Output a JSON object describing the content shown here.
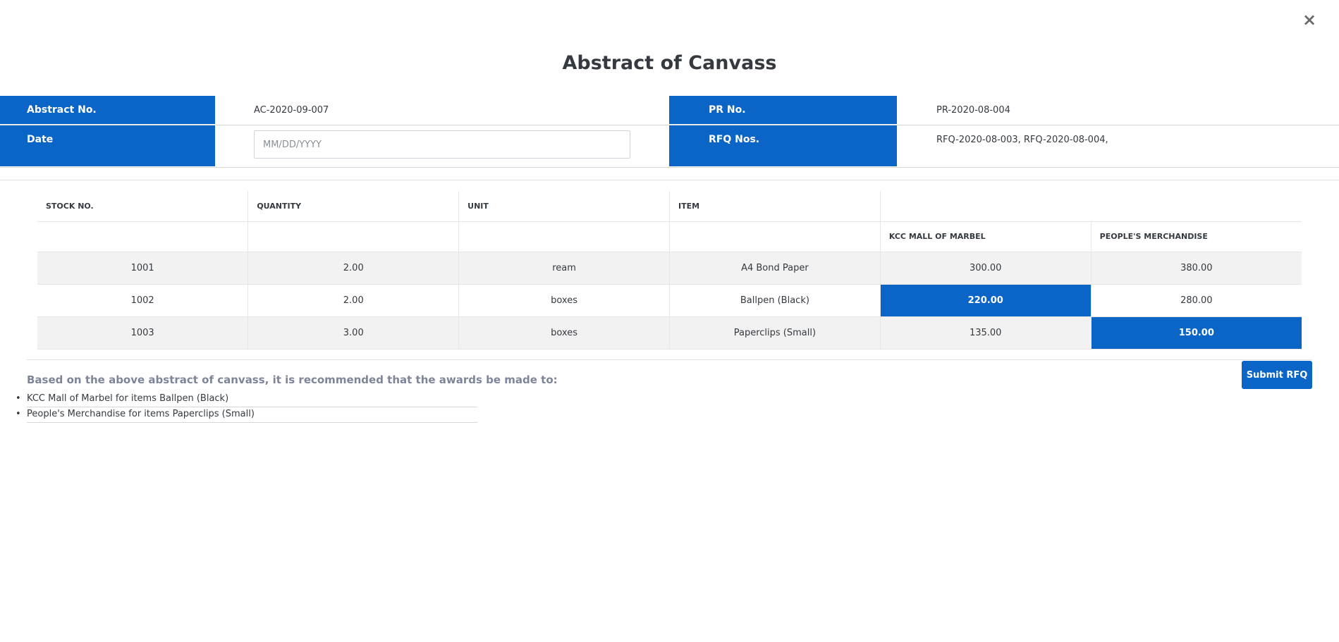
{
  "modal": {
    "close_symbol": "×",
    "close_icon": "close-icon",
    "title": "Abstract of Canvass"
  },
  "info": {
    "abstract_no_label": "Abstract No.",
    "abstract_no_value": "AC-2020-09-007",
    "pr_no_label": "PR No.",
    "pr_no_value": "PR-2020-08-004",
    "date_label": "Date",
    "date_placeholder": "MM/DD/YYYY",
    "date_value": "",
    "rfq_label": "RFQ Nos.",
    "rfq_value": "RFQ-2020-08-003, RFQ-2020-08-004,"
  },
  "table": {
    "headers": [
      "STOCK NO.",
      "QUANTITY",
      "UNIT",
      "ITEM"
    ],
    "suppliers": [
      "KCC MALL OF MARBEL",
      "PEOPLE'S MERCHANDISE"
    ],
    "rows": [
      {
        "stock_no": "1001",
        "quantity": "2.00",
        "unit": "ream",
        "item": "A4 Bond Paper",
        "prices": [
          "300.00",
          "380.00"
        ],
        "awarded_index": null
      },
      {
        "stock_no": "1002",
        "quantity": "2.00",
        "unit": "boxes",
        "item": "Ballpen (Black)",
        "prices": [
          "220.00",
          "280.00"
        ],
        "awarded_index": 0
      },
      {
        "stock_no": "1003",
        "quantity": "3.00",
        "unit": "boxes",
        "item": "Paperclips (Small)",
        "prices": [
          "135.00",
          "150.00"
        ],
        "awarded_index": 1
      }
    ]
  },
  "recommendation": {
    "title": "Based on the above abstract of canvass, it is recommended that the awards be made to:",
    "items": [
      "KCC Mall of Marbel for items Ballpen (Black)",
      "People's Merchandise for items Paperclips (Small)"
    ]
  },
  "actions": {
    "submit_label": "Submit RFQ"
  },
  "colors": {
    "accent": "#0b65c6",
    "row_stripe": "#f2f2f2",
    "muted_text": "#7e8599"
  }
}
